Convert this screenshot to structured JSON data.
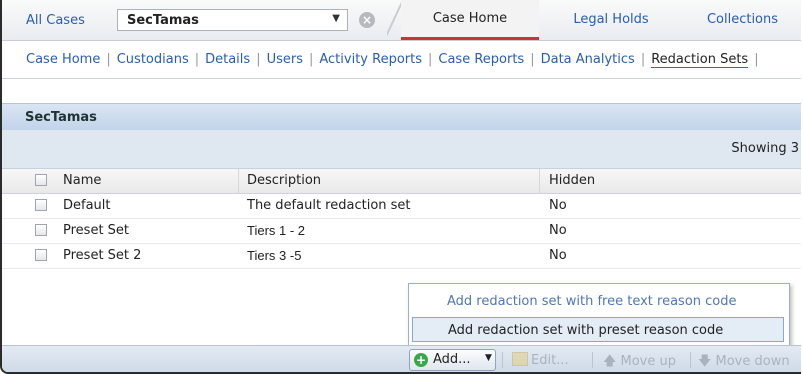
{
  "topbar": {
    "all_cases": "All Cases",
    "case_select_value": "SecTamas",
    "tabs": [
      {
        "label": "Case Home",
        "active": true
      },
      {
        "label": "Legal Holds",
        "active": false
      },
      {
        "label": "Collections",
        "active": false
      }
    ]
  },
  "subnav": {
    "items": [
      "Case Home",
      "Custodians",
      "Details",
      "Users",
      "Activity Reports",
      "Case Reports",
      "Data Analytics",
      "Redaction Sets"
    ],
    "separator": "|",
    "trailing": "|",
    "current": "Redaction Sets"
  },
  "panel": {
    "title": "SecTamas",
    "showing": "Showing  3"
  },
  "table": {
    "columns": [
      "Name",
      "Description",
      "Hidden"
    ],
    "rows": [
      {
        "name": "Default",
        "description": "The default redaction set",
        "hidden": "No"
      },
      {
        "name": "Preset Set",
        "description": "Tiers 1 - 2",
        "hidden": "No"
      },
      {
        "name": "Preset Set 2",
        "description": "Tiers 3 -5",
        "hidden": "No"
      }
    ]
  },
  "menu": {
    "items": [
      "Add redaction set with free text reason code",
      "Add redaction set with preset reason code"
    ]
  },
  "toolbar": {
    "add": "Add...",
    "edit": "Edit...",
    "move_up": "Move up",
    "move_down": "Move down"
  },
  "colors": {
    "link": "#2a5db0",
    "active_tab_underline": "#c8343a",
    "panel_header": "#c2d4ea",
    "add_icon": "#3aa84a"
  }
}
